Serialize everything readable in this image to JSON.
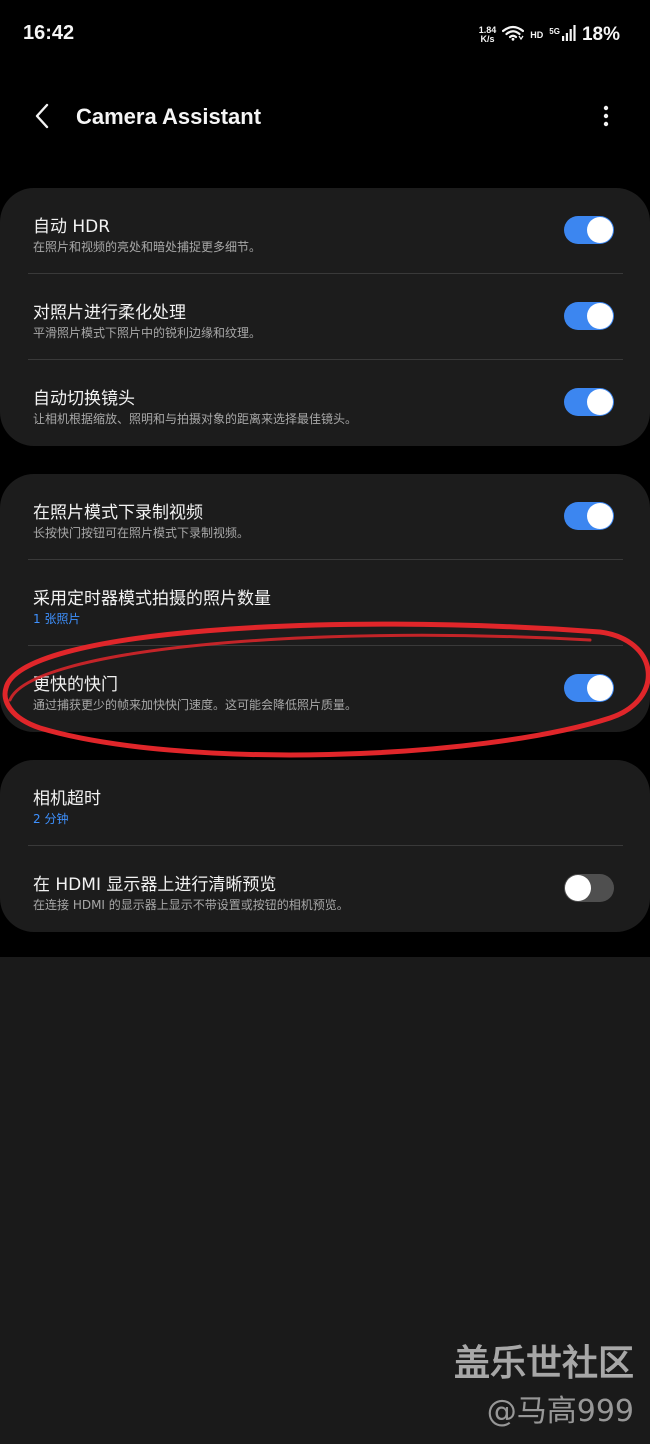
{
  "status_bar": {
    "time": "16:42",
    "net_speed_value": "1.84",
    "net_speed_unit": "K/s",
    "hd": "HD",
    "network_type": "5G",
    "battery": "18%"
  },
  "header": {
    "title": "Camera Assistant"
  },
  "groups": [
    {
      "items": [
        {
          "title": "自动 HDR",
          "subtitle": "在照片和视频的亮处和暗处捕捉更多细节。",
          "toggle": "on"
        },
        {
          "title": "对照片进行柔化处理",
          "subtitle": "平滑照片模式下照片中的锐利边缘和纹理。",
          "toggle": "on"
        },
        {
          "title": "自动切换镜头",
          "subtitle": "让相机根据缩放、照明和与拍摄对象的距离来选择最佳镜头。",
          "toggle": "on"
        }
      ]
    },
    {
      "items": [
        {
          "title": "在照片模式下录制视频",
          "subtitle": "长按快门按钮可在照片模式下录制视频。",
          "toggle": "on"
        },
        {
          "title": "采用定时器模式拍摄的照片数量",
          "subtitle": "1 张照片",
          "toggle": null
        },
        {
          "title": "更快的快门",
          "subtitle": "通过捕获更少的帧来加快快门速度。这可能会降低照片质量。",
          "toggle": "on"
        }
      ]
    },
    {
      "items": [
        {
          "title": "相机超时",
          "subtitle": "2 分钟",
          "toggle": null
        },
        {
          "title": "在 HDMI 显示器上进行清晰预览",
          "subtitle": "在连接 HDMI 的显示器上显示不带设置或按钮的相机预览。",
          "toggle": "off"
        }
      ]
    }
  ],
  "watermark": {
    "line1": "盖乐世社区",
    "line2": "@马高999"
  },
  "colors": {
    "toggle_on": "#3c86f0",
    "toggle_off": "#4f4f4f",
    "accent_value": "#3e91ff",
    "annotation": "#e0262a"
  }
}
